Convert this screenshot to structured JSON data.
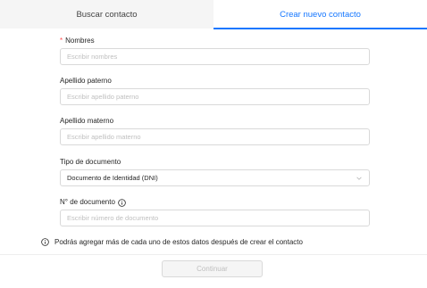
{
  "tabs": [
    {
      "label": "Buscar contacto",
      "active": false
    },
    {
      "label": "Crear nuevo contacto",
      "active": true
    }
  ],
  "form": {
    "nombres": {
      "label": "Nombres",
      "required": true,
      "placeholder": "Escribir nombres"
    },
    "apellido_paterno": {
      "label": "Apellido paterno",
      "placeholder": "Escribir apellido paterno"
    },
    "apellido_materno": {
      "label": "Apellido materno",
      "placeholder": "Escribir apellido materno"
    },
    "tipo_documento": {
      "label": "Tipo de documento",
      "value": "Documento de Identidad (DNI)"
    },
    "numero_documento": {
      "label": "N° de documento",
      "placeholder": "Escribir número de documento"
    }
  },
  "note": "Podrás agregar más de cada uno de estos datos después de crear el contacto",
  "footer": {
    "continue_label": "Continuar",
    "continue_disabled": true
  },
  "icons": {
    "info": "info-icon",
    "select": "chevron-down-icon"
  },
  "colors": {
    "accent": "#1677ff",
    "required": "#ff4d4f"
  }
}
